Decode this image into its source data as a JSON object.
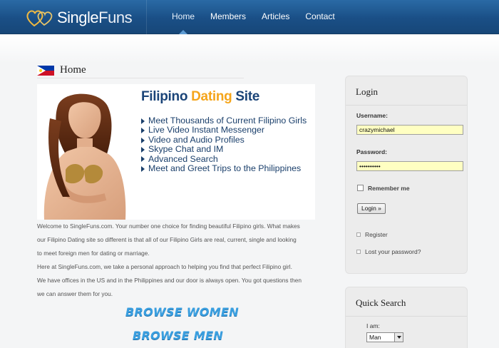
{
  "brand": {
    "name_bold": "Single",
    "name_light": "Funs"
  },
  "nav": {
    "items": [
      {
        "label": "Home",
        "active": true
      },
      {
        "label": "Members",
        "active": false
      },
      {
        "label": "Articles",
        "active": false
      },
      {
        "label": "Contact",
        "active": false
      }
    ]
  },
  "page": {
    "title": "Home"
  },
  "banner": {
    "title_pre": "Filipino ",
    "title_hl": "Dating",
    "title_post": " Site",
    "features": [
      "Meet Thousands of Current Filipino Girls",
      "Live Video Instant Messenger",
      "Video and Audio Profiles",
      "Skype Chat and IM",
      "Advanced Search",
      "Meet and Greet Trips to the Philippines"
    ]
  },
  "content": {
    "p1": "Welcome to SingleFuns.com. Your number one choice for finding beautiful Filipino girls. What makes our Filipino Dating site so different is that all of our Filipino Girls are real, current, single and looking to meet foreign men for dating or marriage.",
    "p2": "Here at SingleFuns.com, we take a personal approach to helping you find that perfect Filipino girl. We have offices in the US and in the Philippines and our door is always open. You got questions then we can answer them for you.",
    "browse_women": "BROWSE WOMEN",
    "browse_men": "BROWSE MEN"
  },
  "login": {
    "title": "Login",
    "username_label": "Username:",
    "username_value": "crazymichael",
    "password_label": "Password:",
    "password_value": "••••••••••",
    "remember_label": "Remember me",
    "button_label": "Login »",
    "register_label": "Register",
    "lost_password_label": "Lost your password?"
  },
  "quick_search": {
    "title": "Quick Search",
    "i_am_label": "I am:",
    "i_am_value": "Man"
  },
  "colors": {
    "header": "#1a4f86",
    "accent": "#f5a51b",
    "brand_blue": "#1a4478",
    "field_bg": "#ffffc2"
  }
}
